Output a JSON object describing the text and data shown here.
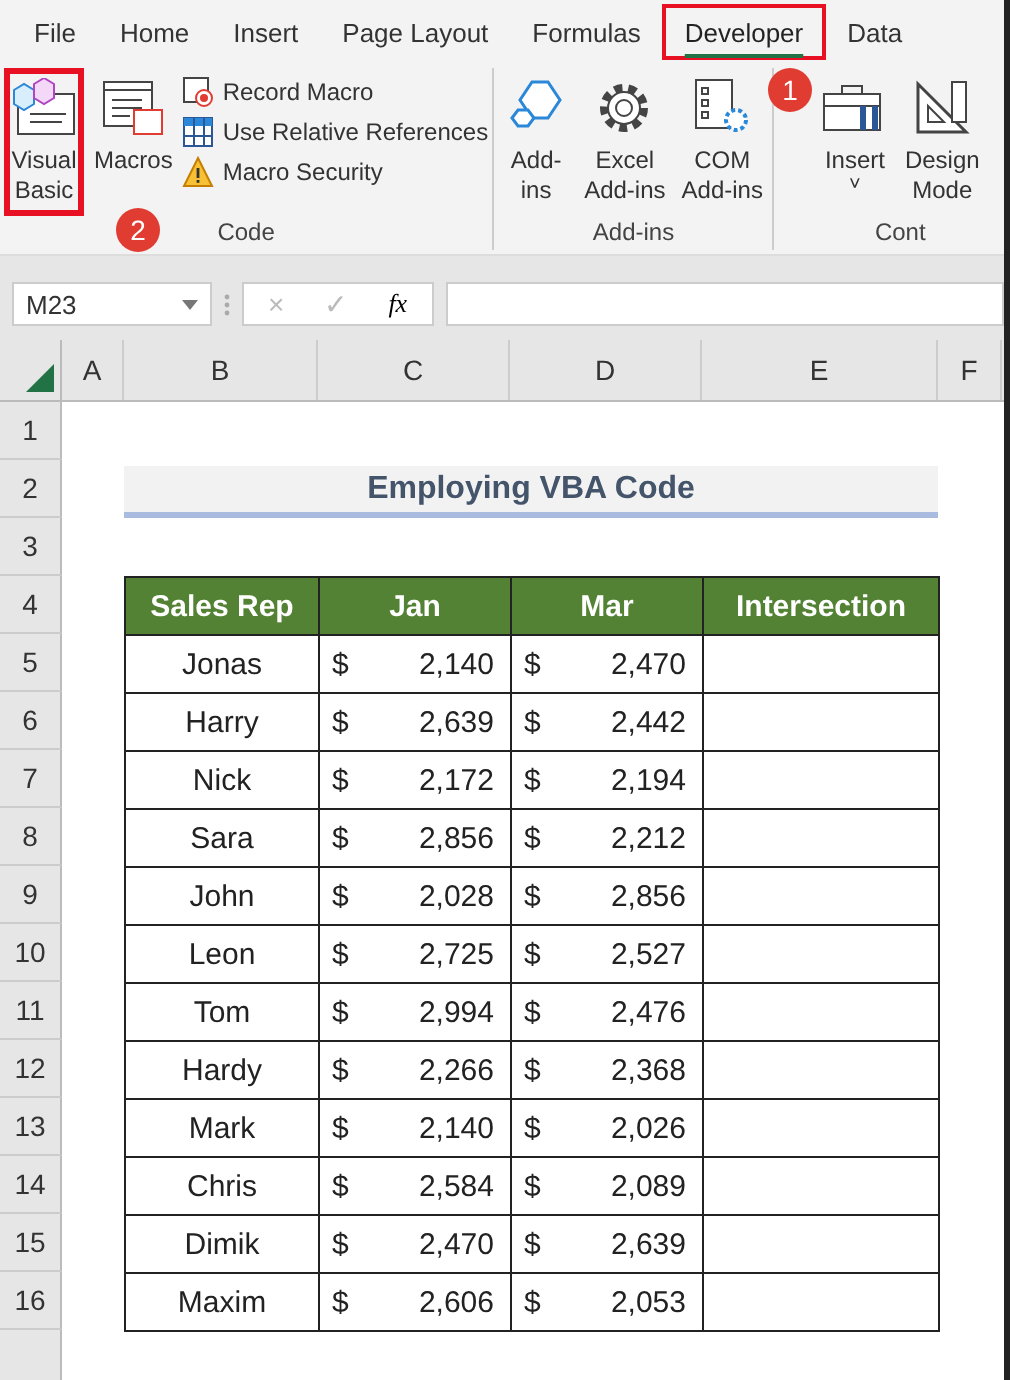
{
  "ribbon_tabs": [
    {
      "label": "File",
      "selected": false,
      "highlighted": false
    },
    {
      "label": "Home",
      "selected": false,
      "highlighted": false
    },
    {
      "label": "Insert",
      "selected": false,
      "highlighted": false
    },
    {
      "label": "Page Layout",
      "selected": false,
      "highlighted": false
    },
    {
      "label": "Formulas",
      "selected": false,
      "highlighted": false
    },
    {
      "label": "Developer",
      "selected": true,
      "highlighted": true
    },
    {
      "label": "Data",
      "selected": false,
      "highlighted": false
    }
  ],
  "ribbon_groups": [
    {
      "label": "Code",
      "large_buttons": [
        {
          "label": "Visual\nBasic",
          "kind": "vb",
          "highlighted": true
        },
        {
          "label": "Macros",
          "kind": "macros",
          "highlighted": false
        }
      ],
      "small_buttons": [
        {
          "label": "Record Macro",
          "kind": "record"
        },
        {
          "label": "Use Relative References",
          "kind": "grid"
        },
        {
          "label": "Macro Security",
          "kind": "warning"
        }
      ]
    },
    {
      "label": "Add-ins",
      "large_buttons": [
        {
          "label": "Add-\nins",
          "kind": "hexagon",
          "highlighted": false
        },
        {
          "label": "Excel\nAdd-ins",
          "kind": "gear",
          "highlighted": false
        },
        {
          "label": "COM\nAdd-ins",
          "kind": "list-gear",
          "highlighted": false
        }
      ]
    },
    {
      "label": "Cont",
      "large_buttons": [
        {
          "label": "Insert",
          "kind": "toolbox",
          "highlighted": false,
          "dropdown": "˅"
        },
        {
          "label": "Design\nMode",
          "kind": "triangle",
          "highlighted": false
        }
      ]
    }
  ],
  "callouts": [
    {
      "text": "1"
    },
    {
      "text": "2"
    }
  ],
  "name_box": "M23",
  "formula_bar": {
    "cancel": "×",
    "enter": "✓",
    "function": "fx"
  },
  "column_headers": [
    "A",
    "B",
    "C",
    "D",
    "E",
    "F"
  ],
  "row_headers": [
    "1",
    "2",
    "3",
    "4",
    "5",
    "6",
    "7",
    "8",
    "9",
    "10",
    "11",
    "12",
    "13",
    "14",
    "15",
    "16"
  ],
  "sheet_title": "Employing VBA Code",
  "table": {
    "columns": [
      "Sales Rep",
      "Jan",
      "Mar",
      "Intersection"
    ],
    "rows": [
      {
        "sales_rep": "Jonas",
        "jan": {
          "currency": "$",
          "amount": "2,140"
        },
        "mar": {
          "currency": "$",
          "amount": "2,470"
        }
      },
      {
        "sales_rep": "Harry",
        "jan": {
          "currency": "$",
          "amount": "2,639"
        },
        "mar": {
          "currency": "$",
          "amount": "2,442"
        }
      },
      {
        "sales_rep": "Nick",
        "jan": {
          "currency": "$",
          "amount": "2,172"
        },
        "mar": {
          "currency": "$",
          "amount": "2,194"
        }
      },
      {
        "sales_rep": "Sara",
        "jan": {
          "currency": "$",
          "amount": "2,856"
        },
        "mar": {
          "currency": "$",
          "amount": "2,212"
        }
      },
      {
        "sales_rep": "John",
        "jan": {
          "currency": "$",
          "amount": "2,028"
        },
        "mar": {
          "currency": "$",
          "amount": "2,856"
        }
      },
      {
        "sales_rep": "Leon",
        "jan": {
          "currency": "$",
          "amount": "2,725"
        },
        "mar": {
          "currency": "$",
          "amount": "2,527"
        }
      },
      {
        "sales_rep": "Tom",
        "jan": {
          "currency": "$",
          "amount": "2,994"
        },
        "mar": {
          "currency": "$",
          "amount": "2,476"
        }
      },
      {
        "sales_rep": "Hardy",
        "jan": {
          "currency": "$",
          "amount": "2,266"
        },
        "mar": {
          "currency": "$",
          "amount": "2,368"
        }
      },
      {
        "sales_rep": "Mark",
        "jan": {
          "currency": "$",
          "amount": "2,140"
        },
        "mar": {
          "currency": "$",
          "amount": "2,026"
        }
      },
      {
        "sales_rep": "Chris",
        "jan": {
          "currency": "$",
          "amount": "2,584"
        },
        "mar": {
          "currency": "$",
          "amount": "2,089"
        }
      },
      {
        "sales_rep": "Dimik",
        "jan": {
          "currency": "$",
          "amount": "2,470"
        },
        "mar": {
          "currency": "$",
          "amount": "2,639"
        }
      },
      {
        "sales_rep": "Maxim",
        "jan": {
          "currency": "$",
          "amount": "2,606"
        },
        "mar": {
          "currency": "$",
          "amount": "2,053"
        }
      }
    ]
  }
}
